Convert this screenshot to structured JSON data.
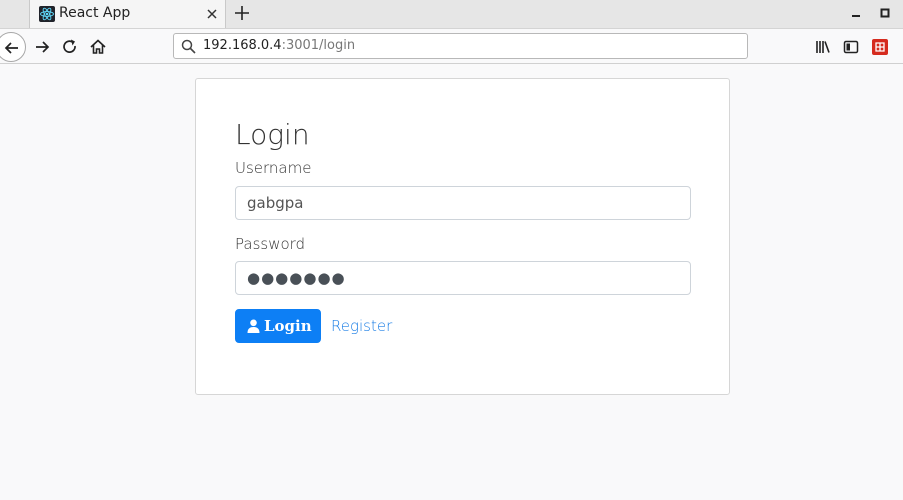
{
  "browser": {
    "tab": {
      "title": "React App"
    },
    "url": {
      "host": "192.168.0.4",
      "path": ":3001/login"
    }
  },
  "login": {
    "title": "Login",
    "username_label": "Username",
    "username_value": "gabgpa",
    "password_label": "Password",
    "password_value": "●●●●●●●",
    "login_button_label": "Login",
    "register_link_label": "Register"
  },
  "colors": {
    "primary": "#0d7ff5",
    "link": "#1d7fe6"
  },
  "icons": {
    "tab_favicon": "react-logo-icon",
    "login_button": "user-icon"
  }
}
